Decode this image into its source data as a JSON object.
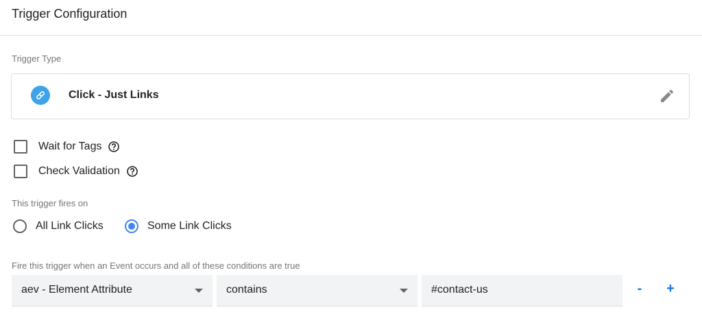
{
  "header": {
    "title": "Trigger Configuration"
  },
  "trigger_type": {
    "label": "Trigger Type",
    "name": "Click - Just Links",
    "icon": "link-icon",
    "edit_icon": "pencil-icon"
  },
  "options": {
    "wait_for_tags": {
      "label": "Wait for Tags",
      "checked": false
    },
    "check_validation": {
      "label": "Check Validation",
      "checked": false
    }
  },
  "fires_on": {
    "label": "This trigger fires on",
    "all_label": "All Link Clicks",
    "some_label": "Some Link Clicks",
    "selected": "some"
  },
  "conditions": {
    "label": "Fire this trigger when an Event occurs and all of these conditions are true",
    "variable": "aev - Element Attribute",
    "operator": "contains",
    "value": "#contact-us",
    "remove_label": "-",
    "add_label": "+"
  },
  "colors": {
    "accent": "#1a73e8",
    "radio_selected": "#4285f4",
    "icon_bg": "#3ea4ea",
    "field_bg": "#f1f3f4"
  }
}
